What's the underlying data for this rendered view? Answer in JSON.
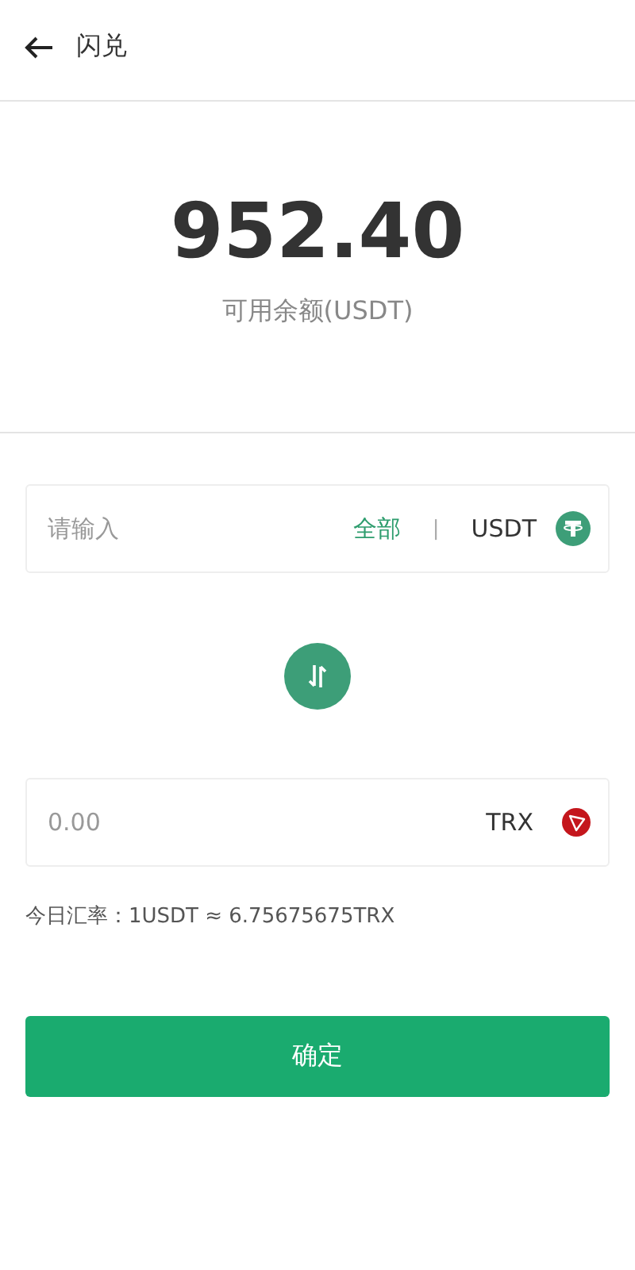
{
  "header": {
    "title": "闪兑"
  },
  "balance": {
    "amount": "952.40",
    "label": "可用余额(USDT)"
  },
  "from": {
    "placeholder": "请输入",
    "all_link": "全部",
    "separator": "|",
    "currency": "USDT",
    "kind": "tether"
  },
  "to": {
    "placeholder": "0.00",
    "currency": "TRX",
    "kind": "tron"
  },
  "rate": "今日汇率：1USDT ≈ 6.75675675TRX",
  "confirm_button": "确定"
}
